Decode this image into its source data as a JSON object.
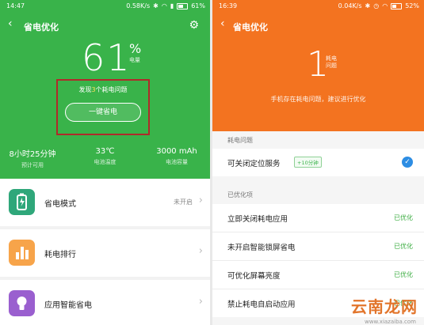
{
  "left": {
    "status": {
      "time": "14:47",
      "speed": "0.58K/s",
      "battery": "61%"
    },
    "title": "省电优化",
    "battery_level": "61",
    "percent_sign": "%",
    "battery_label": "电量",
    "found_prefix": "发现",
    "found_count": "3",
    "found_suffix": "个耗电问题",
    "one_key_button": "一键省电",
    "stats": [
      {
        "value": "8小时25分钟",
        "label": "预计可用"
      },
      {
        "value": "33℃",
        "label": "电池温度"
      },
      {
        "value": "3000 mAh",
        "label": "电池容量"
      }
    ],
    "items": [
      {
        "label": "省电模式",
        "value": "未开启",
        "icon": "battery-mode-icon",
        "color": "#2fa77a"
      },
      {
        "label": "耗电排行",
        "value": "",
        "icon": "bar-chart-icon",
        "color": "#f7a44a"
      },
      {
        "label": "应用智能省电",
        "value": "",
        "icon": "bulb-icon",
        "color": "#9a5fcf"
      }
    ],
    "colors": {
      "header": "#39b34a",
      "highlight_box": "#b02a2a"
    }
  },
  "right": {
    "status": {
      "time": "16:39",
      "speed": "0.04K/s",
      "battery": "52%"
    },
    "title": "省电优化",
    "issue_count": "1",
    "issue_label": "耗电问题",
    "message": "手机存在耗电问题，建议进行优化",
    "section_issues": "耗电问题",
    "issue_item": {
      "label": "可关闭定位服务",
      "tag": "+10分钟"
    },
    "section_optimized": "已优化项",
    "optimized_items": [
      {
        "label": "立即关闭耗电应用",
        "status": "已优化"
      },
      {
        "label": "未开启智能锁屏省电",
        "status": "已优化"
      },
      {
        "label": "可优化屏幕亮度",
        "status": "已优化"
      },
      {
        "label": "禁止耗电自启动应用",
        "status": "已优化"
      }
    ],
    "colors": {
      "header": "#f37320",
      "optimized": "#3fae45",
      "check": "#2d8de3"
    }
  },
  "watermark": {
    "text": "云南龙网",
    "sub": "www.xiazaiba.com"
  }
}
